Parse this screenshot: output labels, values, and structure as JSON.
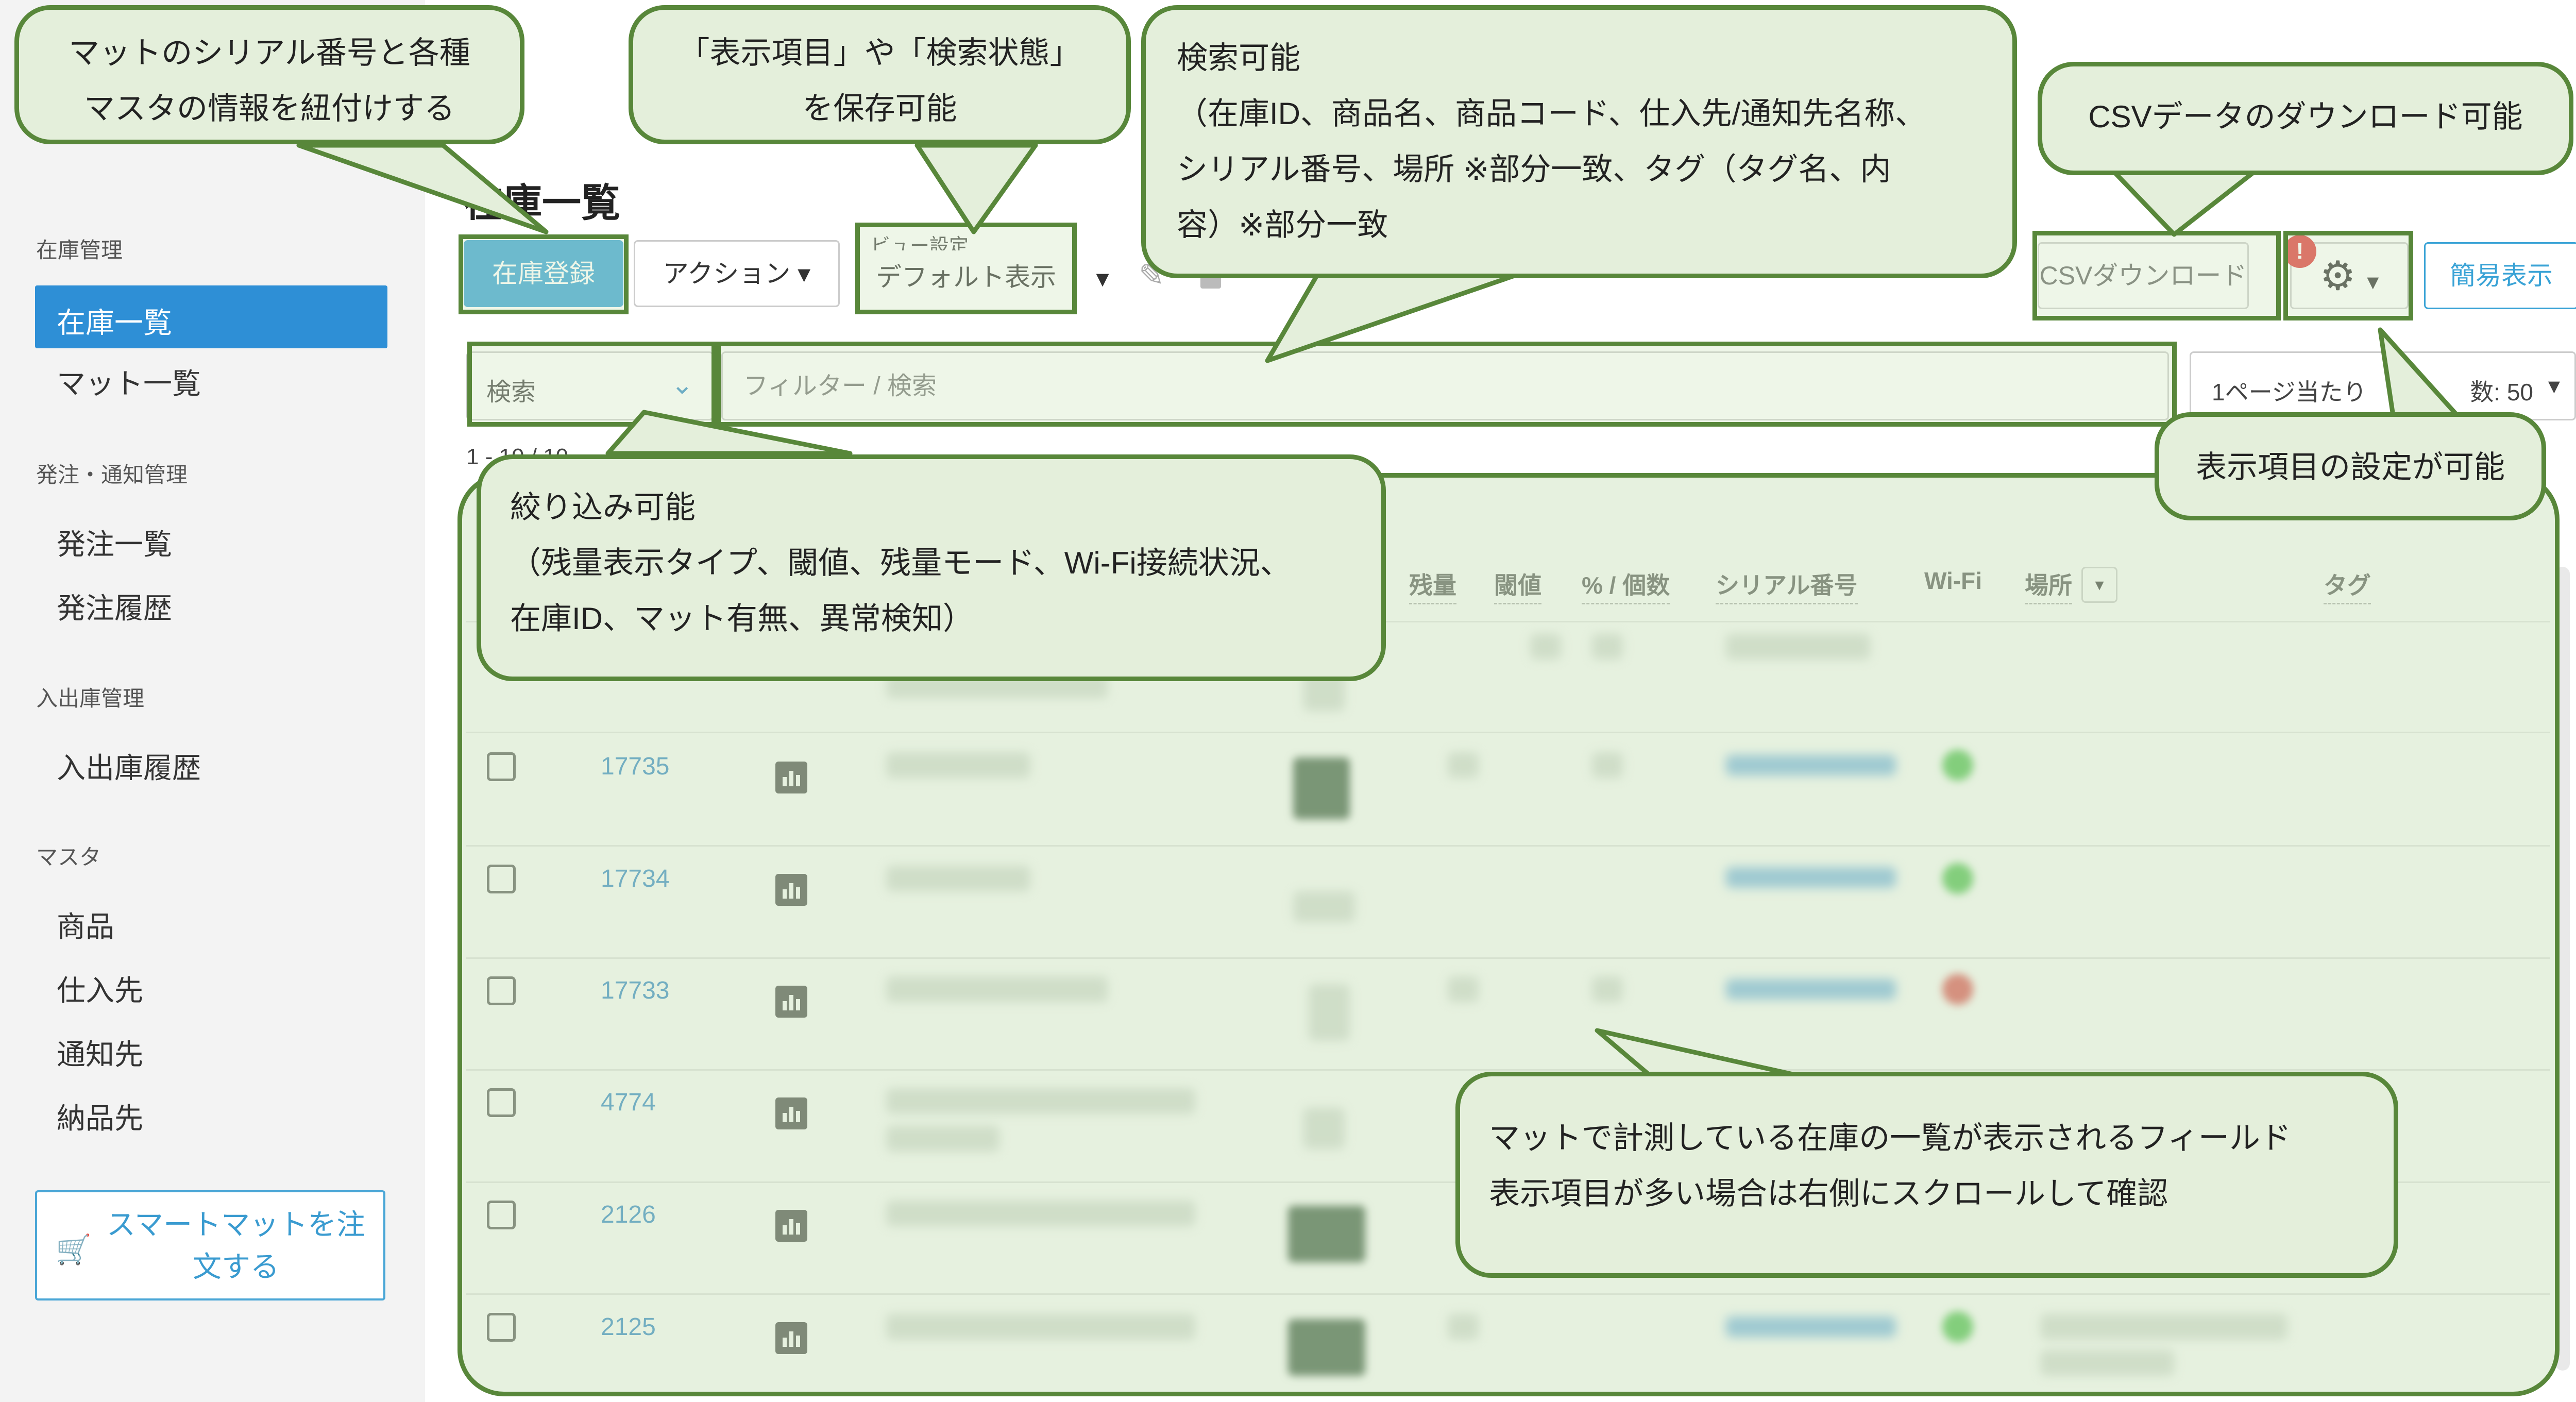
{
  "sidebar": {
    "sections": [
      {
        "label": "在庫管理",
        "items": [
          "在庫一覧",
          "マット一覧"
        ]
      },
      {
        "label": "発注・通知管理",
        "items": [
          "発注一覧",
          "発注履歴"
        ]
      },
      {
        "label": "入出庫管理",
        "items": [
          "入出庫履歴"
        ]
      },
      {
        "label": "マスタ",
        "items": [
          "商品",
          "仕入先",
          "通知先",
          "納品先"
        ]
      }
    ],
    "active_item": "在庫一覧",
    "order_button": "スマートマットを注文する"
  },
  "header": {
    "title": "在庫一覧",
    "register_button": "在庫登録",
    "action_button": "アクション",
    "view_label": "ビュー設定",
    "view_value": "デフォルト表示",
    "csv_button": "CSVダウンロード",
    "gear_badge": "!",
    "simple_button": "簡易表示"
  },
  "toolbar": {
    "search_select": "検索",
    "filter_placeholder": "フィルター / 検索",
    "per_page_label": "1ページ当たり",
    "per_page_value": "数: 50",
    "range_text": "1 - 10 / 10"
  },
  "table": {
    "columns": [
      "残量",
      "閾値",
      "% / 個数",
      "シリアル番号",
      "Wi-Fi",
      "場所",
      "タグ"
    ],
    "rows": [
      {
        "id": "17735",
        "wifi": "green"
      },
      {
        "id": "17734",
        "wifi": "green"
      },
      {
        "id": "17733",
        "wifi": "red"
      },
      {
        "id": "4774",
        "wifi": ""
      },
      {
        "id": "2126",
        "wifi": ""
      },
      {
        "id": "2125",
        "wifi": "green"
      }
    ]
  },
  "callouts": {
    "mat_link": "マットのシリアル番号と各種\nマスタの情報を紐付けする",
    "save_view": "「表示項目」や「検索状態」\nを保存可能",
    "search": "検索可能\n（在庫ID、商品名、商品コード、仕入先/通知先名称、\nシリアル番号、場所 ※部分一致、タグ（タグ名、内\n容）※部分一致",
    "csv": "CSVデータのダウンロード可能",
    "display_setting": "表示項目の設定が可能",
    "filter": "絞り込み可能\n（残量表示タイプ、閾値、残量モード、Wi-Fi接続状況、\n在庫ID、マット有無、異常検知）",
    "field": "マットで計測している在庫の一覧が表示されるフィールド\n表示項目が多い場合は右側にスクロールして確認"
  },
  "colors": {
    "accent": "#2e8fd6",
    "callout_border": "#58873a",
    "callout_fill": "#e4efdb"
  }
}
